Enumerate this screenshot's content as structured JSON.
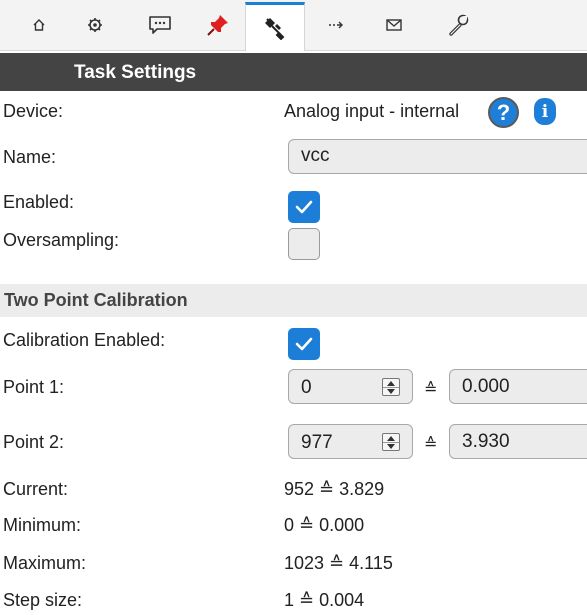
{
  "tabs": [
    {
      "icon": "home-icon",
      "active": false
    },
    {
      "icon": "gear-icon",
      "active": false
    },
    {
      "icon": "chat-icon",
      "active": false
    },
    {
      "icon": "pin-icon",
      "active": false
    },
    {
      "icon": "plug-icon",
      "active": true
    },
    {
      "icon": "arrow-right-icon",
      "active": false
    },
    {
      "icon": "mail-icon",
      "active": false
    },
    {
      "icon": "wrench-icon",
      "active": false
    }
  ],
  "header": {
    "title": "Task Settings"
  },
  "device": {
    "label": "Device:",
    "value": "Analog input - internal",
    "help_glyph": "?",
    "info_glyph": "i"
  },
  "name": {
    "label": "Name:",
    "value": "vcc"
  },
  "enabled": {
    "label": "Enabled:",
    "checked": true
  },
  "oversampling": {
    "label": "Oversampling:",
    "checked": false
  },
  "calibration": {
    "section_title": "Two Point Calibration",
    "enabled_label": "Calibration Enabled:",
    "enabled_checked": true,
    "eq_symbol": "≙",
    "point1": {
      "label": "Point 1:",
      "raw": "0",
      "value": "0.000"
    },
    "point2": {
      "label": "Point 2:",
      "raw": "977",
      "value": "3.930"
    }
  },
  "stats": {
    "current": {
      "label": "Current:",
      "value": "952 ≙ 3.829"
    },
    "minimum": {
      "label": "Minimum:",
      "value": "0 ≙ 0.000"
    },
    "maximum": {
      "label": "Maximum:",
      "value": "1023 ≙ 4.115"
    },
    "step": {
      "label": "Step size:",
      "value": "1 ≙ 0.004"
    }
  },
  "colors": {
    "accent": "#1d7ed8",
    "header_bg": "#444444",
    "section_bg": "#ececec"
  }
}
